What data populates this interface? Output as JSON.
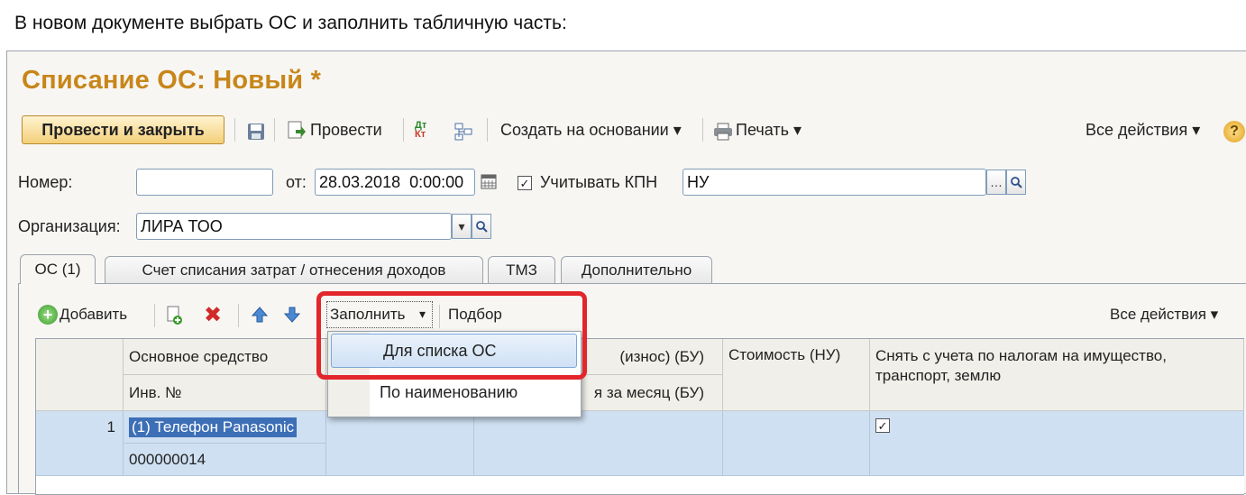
{
  "instruction": "В новом документе выбрать ОС и заполнить табличную часть:",
  "window": {
    "title": "Списание ОС: Новый *"
  },
  "toolbar": {
    "post_close": "Провести и закрыть",
    "post": "Провести",
    "create_based": "Создать на основании ▾",
    "print": "Печать ▾",
    "all_actions": "Все действия ▾",
    "dtkt_icon": "debit-credit-icon",
    "help": "?"
  },
  "form": {
    "number_label": "Номер:",
    "number_value": "",
    "date_label": "от:",
    "date_value": "28.03.2018  0:00:00",
    "kpn_label": "Учитывать КПН",
    "kpn_checked": "✓",
    "kpn_value": "НУ",
    "org_label": "Организация:",
    "org_value": "ЛИРА ТОО"
  },
  "tabs": [
    {
      "label": "ОС (1)"
    },
    {
      "label": "Счет списания затрат / отнесения доходов"
    },
    {
      "label": "ТМЗ"
    },
    {
      "label": "Дополнительно"
    }
  ],
  "tab_toolbar": {
    "add": "Добавить",
    "fill": "Заполнить",
    "fill_arrow": "▾",
    "pick": "Подбор",
    "all_actions": "Все действия ▾"
  },
  "grid": {
    "headers": {
      "asset": "Основное средство",
      "inv": "Инв. №",
      "wear": "(износ) (БУ)",
      "month": "я за месяц (БУ)",
      "cost_nu": "Стоимость (НУ)",
      "deregister": "Снять с учета по налогам на имущество, транспорт, землю"
    },
    "rows": [
      {
        "num": "1",
        "asset": "(1) Телефон Panasonic",
        "inv": "000000014",
        "deregister": "✓"
      }
    ]
  },
  "menu": {
    "items": [
      {
        "label": "Для списка ОС"
      },
      {
        "label": "По наименованию"
      }
    ]
  },
  "colors": {
    "title": "#c8861a",
    "highlight_frame": "#e2262b",
    "selected_row": "#cfe0f2"
  }
}
